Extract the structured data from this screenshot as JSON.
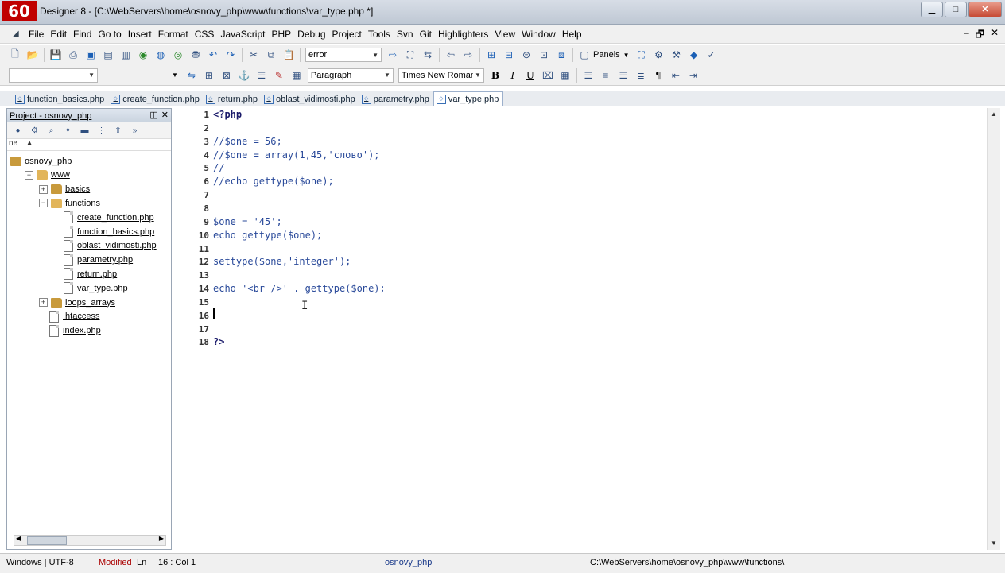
{
  "window": {
    "logo": "60",
    "title": "Designer 8 - [C:\\WebServers\\home\\osnovy_php\\www\\functions\\var_type.php *]",
    "minimize": "▁",
    "maximize": "□",
    "close": "✕"
  },
  "menu": {
    "items": [
      "File",
      "Edit",
      "Find",
      "Go to",
      "Insert",
      "Format",
      "CSS",
      "JavaScript",
      "PHP",
      "Debug",
      "Project",
      "Tools",
      "Svn",
      "Git",
      "Highlighters",
      "View",
      "Window",
      "Help"
    ],
    "mdi": [
      "–",
      "🗗",
      "✕"
    ]
  },
  "toolbar": {
    "search_value": "error",
    "panels_label": "Panels"
  },
  "format_toolbar": {
    "paragraph_value": "Paragraph",
    "font_value": "Times New Roman",
    "bold": "B",
    "italic": "I",
    "underline": "U",
    "pilcrow": "¶"
  },
  "tabs": [
    {
      "label": "function_basics.php",
      "active": false
    },
    {
      "label": "create_function.php",
      "active": false
    },
    {
      "label": "return.php",
      "active": false
    },
    {
      "label": "oblast_vidimosti.php",
      "active": false
    },
    {
      "label": "parametry.php",
      "active": false
    },
    {
      "label": "var_type.php",
      "active": true
    }
  ],
  "project": {
    "title": "Project - osnovy_php",
    "col_header": "ne",
    "tree": [
      {
        "label": "osnovy_php",
        "type": "folder",
        "depth": 0,
        "expander": ""
      },
      {
        "label": "www",
        "type": "folder",
        "depth": 1,
        "expander": "-"
      },
      {
        "label": "basics",
        "type": "folder",
        "depth": 2,
        "expander": "+"
      },
      {
        "label": "functions",
        "type": "folder",
        "depth": 2,
        "expander": "-"
      },
      {
        "label": "create_function.php",
        "type": "file",
        "depth": 3,
        "expander": ""
      },
      {
        "label": "function_basics.php",
        "type": "file",
        "depth": 3,
        "expander": ""
      },
      {
        "label": "oblast_vidimosti.php",
        "type": "file",
        "depth": 3,
        "expander": ""
      },
      {
        "label": "parametry.php",
        "type": "file",
        "depth": 3,
        "expander": ""
      },
      {
        "label": "return.php",
        "type": "file",
        "depth": 3,
        "expander": ""
      },
      {
        "label": "var_type.php",
        "type": "file",
        "depth": 3,
        "expander": ""
      },
      {
        "label": "loops_arrays",
        "type": "folder",
        "depth": 2,
        "expander": "+"
      },
      {
        "label": ".htaccess",
        "type": "file",
        "depth": 2,
        "expander": ""
      },
      {
        "label": "index.php",
        "type": "file",
        "depth": 2,
        "expander": ""
      }
    ]
  },
  "editor": {
    "lines": [
      {
        "no": "1",
        "text": "<?php",
        "kind": "tag"
      },
      {
        "no": "2",
        "text": "",
        "kind": "code"
      },
      {
        "no": "3",
        "text": "//$one = 56;",
        "kind": "code"
      },
      {
        "no": "4",
        "text": "//$one = array(1,45,'слово');",
        "kind": "code"
      },
      {
        "no": "5",
        "text": "//",
        "kind": "code"
      },
      {
        "no": "6",
        "text": "//echo gettype($one);",
        "kind": "code"
      },
      {
        "no": "7",
        "text": "",
        "kind": "code"
      },
      {
        "no": "8",
        "text": "",
        "kind": "code"
      },
      {
        "no": "9",
        "text": "$one = '45';",
        "kind": "code"
      },
      {
        "no": "10",
        "text": "echo gettype($one);",
        "kind": "code"
      },
      {
        "no": "11",
        "text": "",
        "kind": "code"
      },
      {
        "no": "12",
        "text": "settype($one,'integer');",
        "kind": "code"
      },
      {
        "no": "13",
        "text": "",
        "kind": "code"
      },
      {
        "no": "14",
        "text": "echo '<br />' . gettype($one);",
        "kind": "code"
      },
      {
        "no": "15",
        "text": "",
        "kind": "code"
      },
      {
        "no": "16",
        "text": "",
        "kind": "code"
      },
      {
        "no": "17",
        "text": "",
        "kind": "code"
      },
      {
        "no": "18",
        "text": "?>",
        "kind": "tag"
      }
    ]
  },
  "status": {
    "encoding": "Windows | UTF-8",
    "modified": "Modified",
    "ln_label": "Ln",
    "position": "16 : Col  1",
    "project": "osnovy_php",
    "path": "C:\\WebServers\\home\\osnovy_php\\www\\functions\\"
  }
}
